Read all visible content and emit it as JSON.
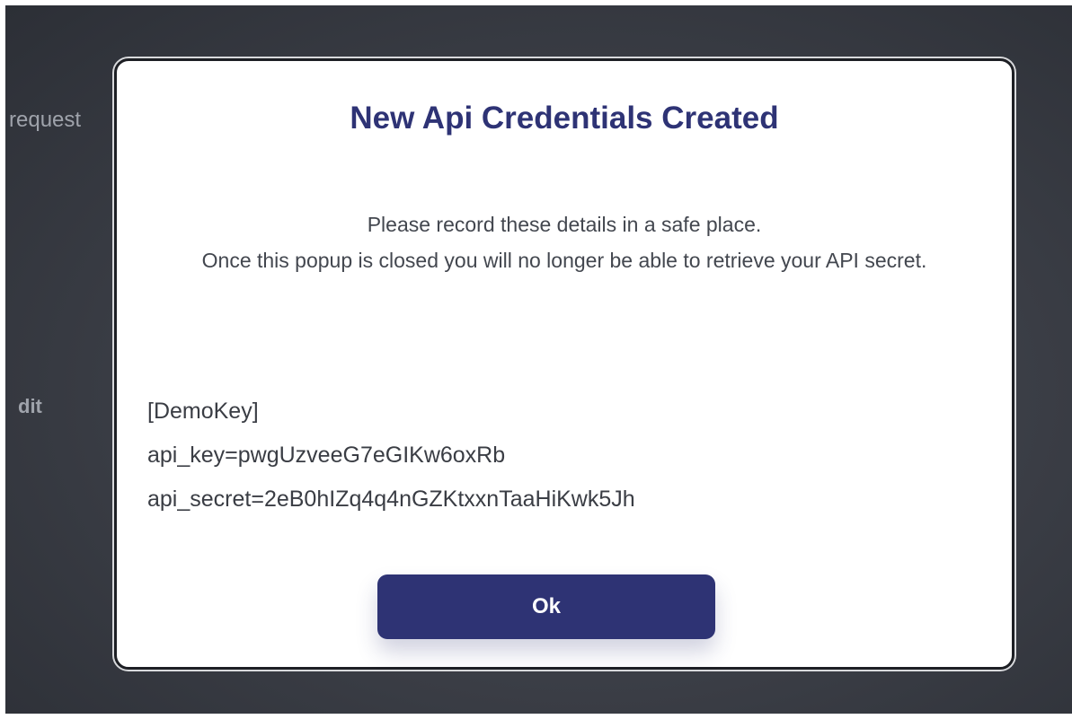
{
  "background": {
    "partial_label_1": "request",
    "partial_label_2": "dit"
  },
  "modal": {
    "title": "New Api Credentials Created",
    "message_line_1": "Please record these details in a safe place.",
    "message_line_2": "Once this popup is closed you will no longer be able to retrieve your API secret.",
    "credentials": {
      "key_name": "[DemoKey]",
      "api_key": "api_key=pwgUzveeG7eGIKw6oxRb",
      "api_secret": "api_secret=2eB0hIZq4q4nGZKtxxnTaaHiKwk5Jh"
    },
    "ok_label": "Ok"
  },
  "colors": {
    "accent": "#2e3374",
    "title": "#2e3375",
    "backdrop": "#3a3d45"
  }
}
